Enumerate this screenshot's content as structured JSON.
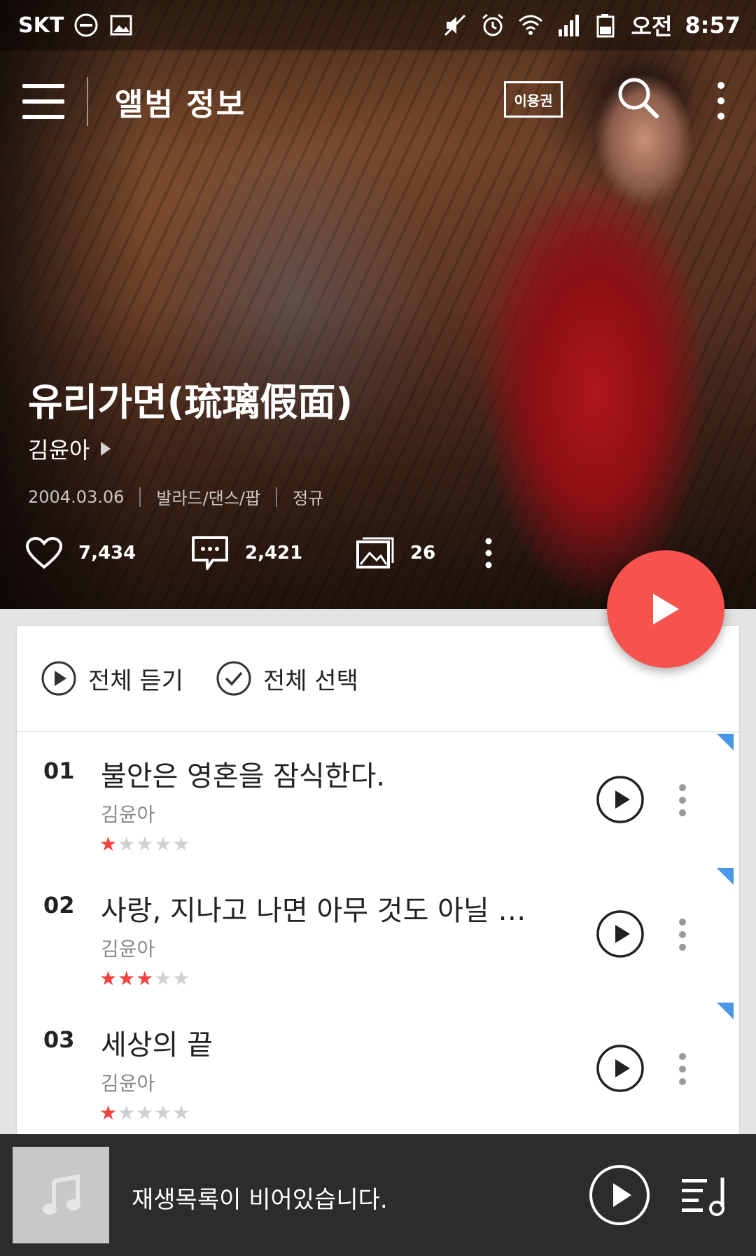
{
  "status_bar": {
    "carrier": "SKT",
    "time_period": "오전",
    "time": "8:57"
  },
  "toolbar": {
    "title": "앨범 정보",
    "ticket_label": "이용권"
  },
  "album": {
    "title": "유리가면(琉璃假面)",
    "artist": "김윤아",
    "release_date": "2004.03.06",
    "genre": "발라드/댄스/팝",
    "album_type": "정규",
    "likes": "7,434",
    "comments": "2,421",
    "photos": "26"
  },
  "list_actions": {
    "play_all": "전체 듣기",
    "select_all": "전체 선택"
  },
  "tracks": [
    {
      "num": "01",
      "title": "불안은 영혼을 잠식한다.",
      "artist": "김윤아",
      "rating": 1,
      "rating_max": 5
    },
    {
      "num": "02",
      "title": "사랑, 지나고 나면 아무 것도 아닐 …",
      "artist": "김윤아",
      "rating": 3,
      "rating_max": 5
    },
    {
      "num": "03",
      "title": "세상의 끝",
      "artist": "김윤아",
      "rating": 1,
      "rating_max": 5
    }
  ],
  "player": {
    "message": "재생목록이 비어있습니다."
  },
  "colors": {
    "accent": "#f6534e",
    "star_on": "#f2423e",
    "star_off": "#d0d0d0",
    "flag": "#4a96e8",
    "player_bg": "#2c2c2c"
  },
  "icons": {
    "menu": "menu-icon",
    "search": "search-icon",
    "more": "more-vert-icon",
    "like": "heart-icon",
    "comment": "comment-icon",
    "photo": "image-icon",
    "play": "play-icon",
    "check": "check-circle-icon",
    "queue": "playlist-icon",
    "music_note": "music-note-icon"
  }
}
